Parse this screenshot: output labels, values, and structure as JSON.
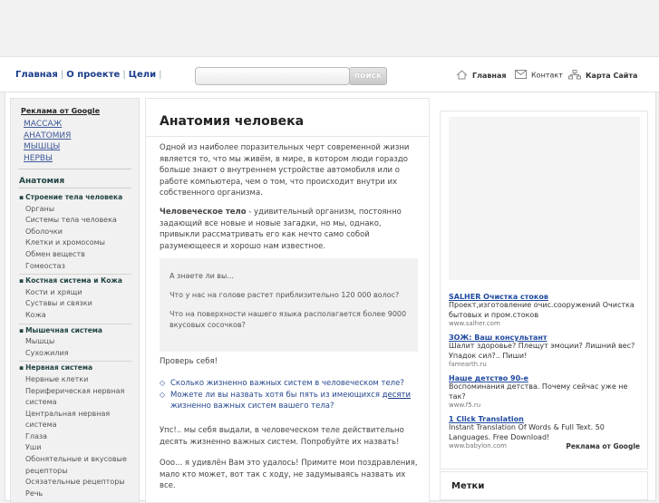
{
  "topnav": {
    "home": "Главная",
    "about": "О проекте",
    "goals": "Цели"
  },
  "search": {
    "button": "поиск",
    "placeholder": ""
  },
  "rightnav": {
    "home": "Главная",
    "contact": "Контакт",
    "sitemap": "Карта Сайта"
  },
  "sidebar": {
    "ads_title": "Реклама от Google",
    "ad_links": [
      "МАССАЖ",
      "АНАТОМИЯ",
      "МЫШЦЫ",
      "НЕРВЫ"
    ],
    "heading": "Анатомия",
    "sections": [
      {
        "title": "Строение тела человека",
        "items": [
          "Органы",
          "Системы тела человека",
          "Оболочки",
          "Клетки и хромосомы",
          "Обмен веществ",
          "Гомеостаз"
        ]
      },
      {
        "title": "Костная система и Кожа",
        "items": [
          "Кости и хрящи",
          "Суставы и связки",
          "Кожа"
        ]
      },
      {
        "title": "Мышечная система",
        "items": [
          "Мышцы",
          "Сухожилия"
        ]
      },
      {
        "title": "Нервная система",
        "items": [
          "Нервные клетки",
          "Периферическая нервная система",
          "Центральная нервная система",
          "Глаза",
          "Уши",
          "Обонятельные и вкусовые рецепторы",
          "Осязательные рецепторы",
          "Речь"
        ]
      }
    ]
  },
  "main": {
    "title": "Анатомия человека",
    "p1": "Одной из наиболее поразительных черт современной жизни является то, что мы живём, в мире, в котором люди гораздо больше знают о внутреннем устройстве автомобиля или о работе компьютера, чем о том, что происходит внутри их собственного организма.",
    "p2_bold": "Человеческое тело",
    "p2": " - удивительный организм, постоянно задающий все новые и новые загадки, но мы, однако, привыкли рассматривать его как нечто само собой разумеющееся и хорошо нам известное.",
    "quote": {
      "q1": "А знаете ли вы...",
      "q2": "Что у нас на голове растет приблизительно 120 000 волос?",
      "q3": "Что на поверхности нашего языка располагается более 9000 вкусовых сосочков?"
    },
    "check": "Проверь себя!",
    "list": [
      "Сколько жизненно важных систем в человеческом теле?",
      "Можете ли вы назвать хотя бы пять из имеющихся "
    ],
    "list_link": "десяти",
    "list_tail": " жизненно важных систем вашего тела?",
    "p3": "Упс!.. мы себя выдали, в человеческом теле действительно десять жизненно важных систем. Попробуйте их назвать!",
    "p4": "Ооо... я удивлён Вам это удалось! Примите мои поздравления, мало кто может, вот так с ходу, не задумываясь назвать их все."
  },
  "ads": [
    {
      "title": "SALHER Очистка стоков",
      "desc": "Проект,изготовление очис.сооружений Очистка бытовых и пром.стоков",
      "url": "www.salher.com"
    },
    {
      "title": "ЗОЖ: Ваш консультант",
      "desc": "Шалит здоровье? Плещут эмоции? Лишний вес? Упадок сил?.. Пиши!",
      "url": "famearth.ru"
    },
    {
      "title": "Наше детство 90-е",
      "desc": "Воспоминания детства. Почему сейчас уже не так?",
      "url": "www.f5.ru"
    },
    {
      "title": "1 Click Translation",
      "desc": "Instant Translation Of Words & Full Text. 50 Languages. Free Download!",
      "url": "www.babylon.com"
    }
  ],
  "ads_footer": "Реклама от Google",
  "tags_title": "Метки"
}
